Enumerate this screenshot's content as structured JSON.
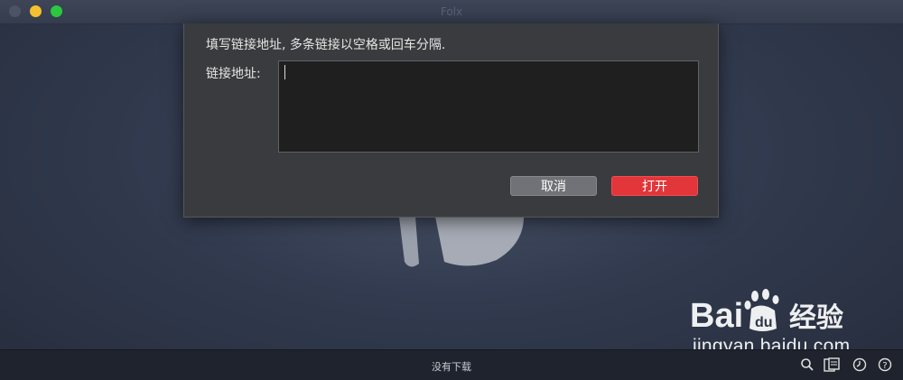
{
  "window": {
    "title": "Folx"
  },
  "dialog": {
    "instruction": "填写链接地址, 多条链接以空格或回车分隔.",
    "url_label": "链接地址:",
    "url_value": "",
    "cancel_label": "取消",
    "open_label": "打开"
  },
  "bottom_bar": {
    "status": "没有下载",
    "icons": [
      "search-icon",
      "clipboard-icon",
      "clock-icon",
      "help-icon"
    ]
  },
  "watermark": {
    "brand": "Bai du 经验",
    "url": "jingyan.baidu.com"
  },
  "colors": {
    "open_button": "#e2363a",
    "cancel_button": "#707277",
    "dialog_bg": "#3a3b3e",
    "input_bg": "#1f1f20"
  }
}
